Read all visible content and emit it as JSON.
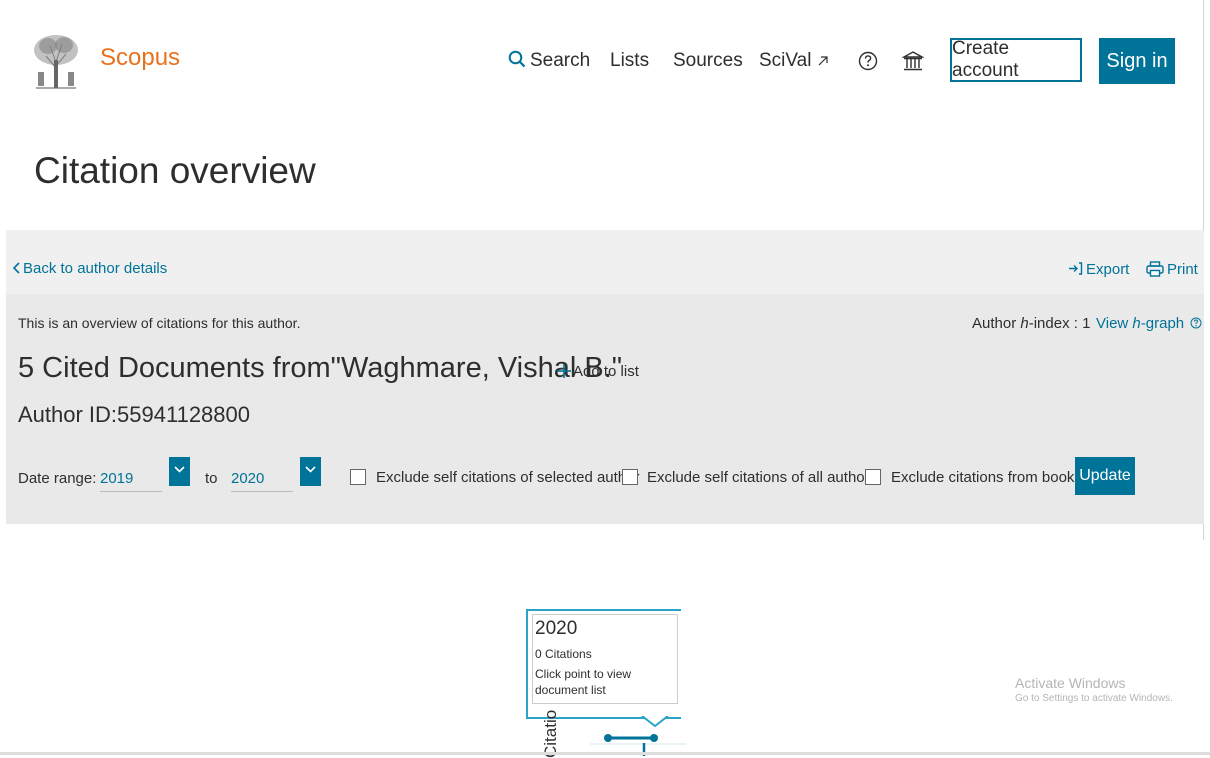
{
  "header": {
    "brand": "Scopus",
    "nav": {
      "search": "Search",
      "lists": "Lists",
      "sources": "Sources",
      "scival": "SciVal"
    },
    "create_account": "Create account",
    "sign_in": "Sign in"
  },
  "page": {
    "title": "Citation overview"
  },
  "toolbar": {
    "back": "Back to author details",
    "export": "Export",
    "print": "Print"
  },
  "overview": {
    "intro": "This is an overview of citations for this author.",
    "hindex_prefix": "Author ",
    "hindex_h": "h",
    "hindex_suffix": "-index : 1",
    "view_prefix": "View ",
    "view_h": "h",
    "view_suffix": "-graph",
    "cited_documents": "5 Cited Documents from\"Waghmare, Vishal B.\"",
    "add_to_list": "Add to list",
    "author_id": "Author ID:55941128800"
  },
  "filters": {
    "date_range_label": "Date range:",
    "from_year": "2019",
    "to_label": "to",
    "to_year": "2020",
    "exclude_self_selected": "Exclude self citations of selected author",
    "exclude_self_all": "Exclude self citations of all authors",
    "exclude_books": "Exclude citations from books",
    "update": "Update"
  },
  "chart": {
    "tooltip_year": "2020",
    "tooltip_citations": "0 Citations",
    "tooltip_hint": "Click point to view document list",
    "axis_label_partial": "Citatio"
  },
  "watermark": {
    "title": "Activate Windows",
    "subtitle": "Go to Settings to activate Windows."
  },
  "colors": {
    "brand": "#e9711c",
    "accent": "#007398",
    "tooltip_border": "#29a3c7"
  }
}
